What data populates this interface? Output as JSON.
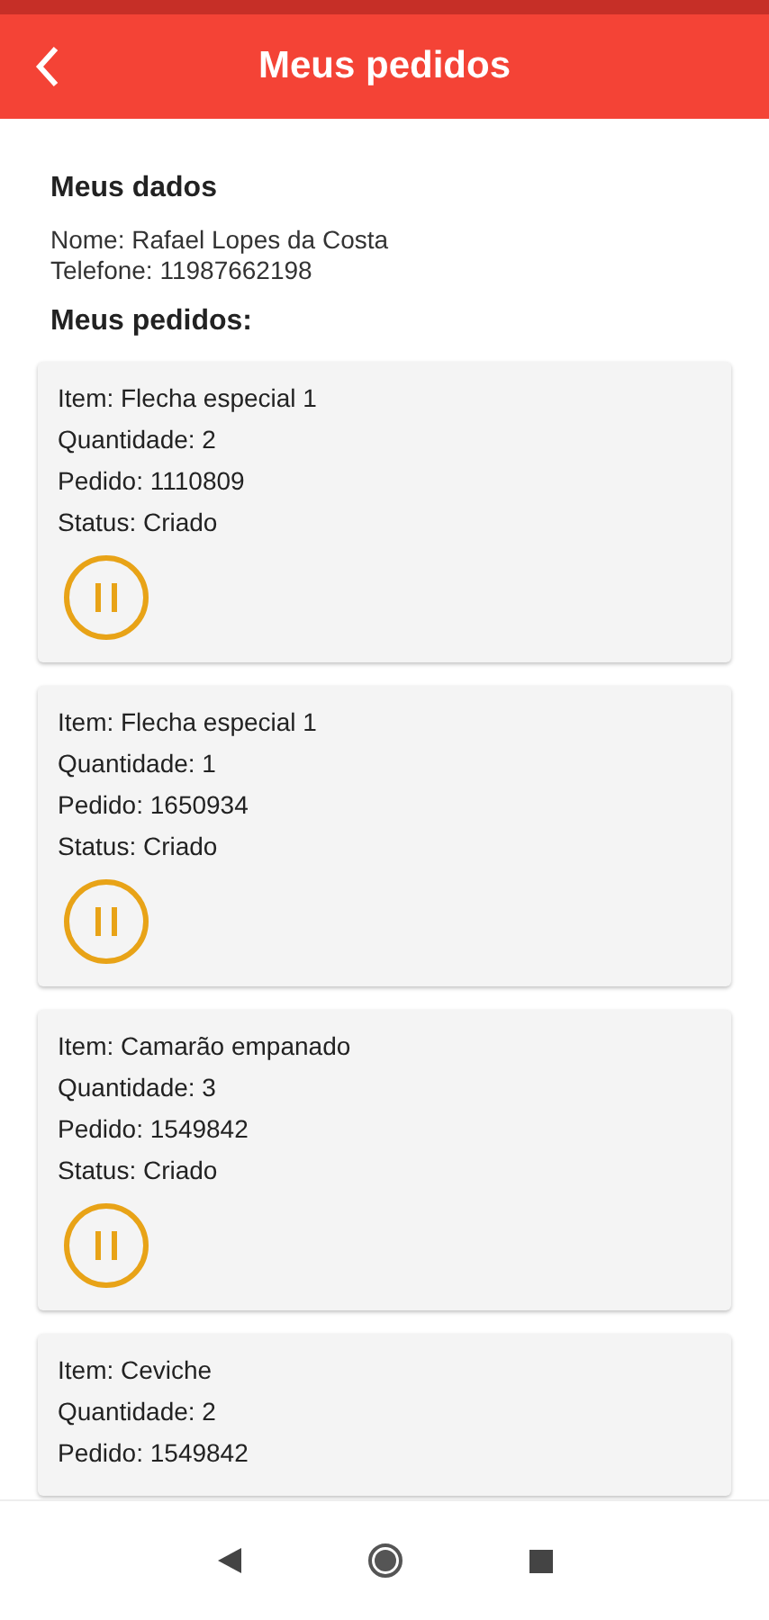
{
  "header": {
    "title": "Meus pedidos"
  },
  "profile": {
    "heading": "Meus dados",
    "lines": [
      "Nome: Rafael Lopes da Costa",
      "Telefone: 11987662198"
    ]
  },
  "orders_heading": "Meus pedidos:",
  "orders": [
    {
      "item": "Item: Flecha especial 1",
      "quantity": "Quantidade: 2",
      "order": "Pedido: 1110809",
      "status": "Status: Criado"
    },
    {
      "item": "Item: Flecha especial 1",
      "quantity": "Quantidade: 1",
      "order": "Pedido: 1650934",
      "status": "Status: Criado"
    },
    {
      "item": "Item: Camarão empanado",
      "quantity": "Quantidade: 3",
      "order": "Pedido: 1549842",
      "status": "Status: Criado"
    },
    {
      "item": "Item: Ceviche",
      "quantity": "Quantidade: 2",
      "order": "Pedido: 1549842"
    }
  ]
}
